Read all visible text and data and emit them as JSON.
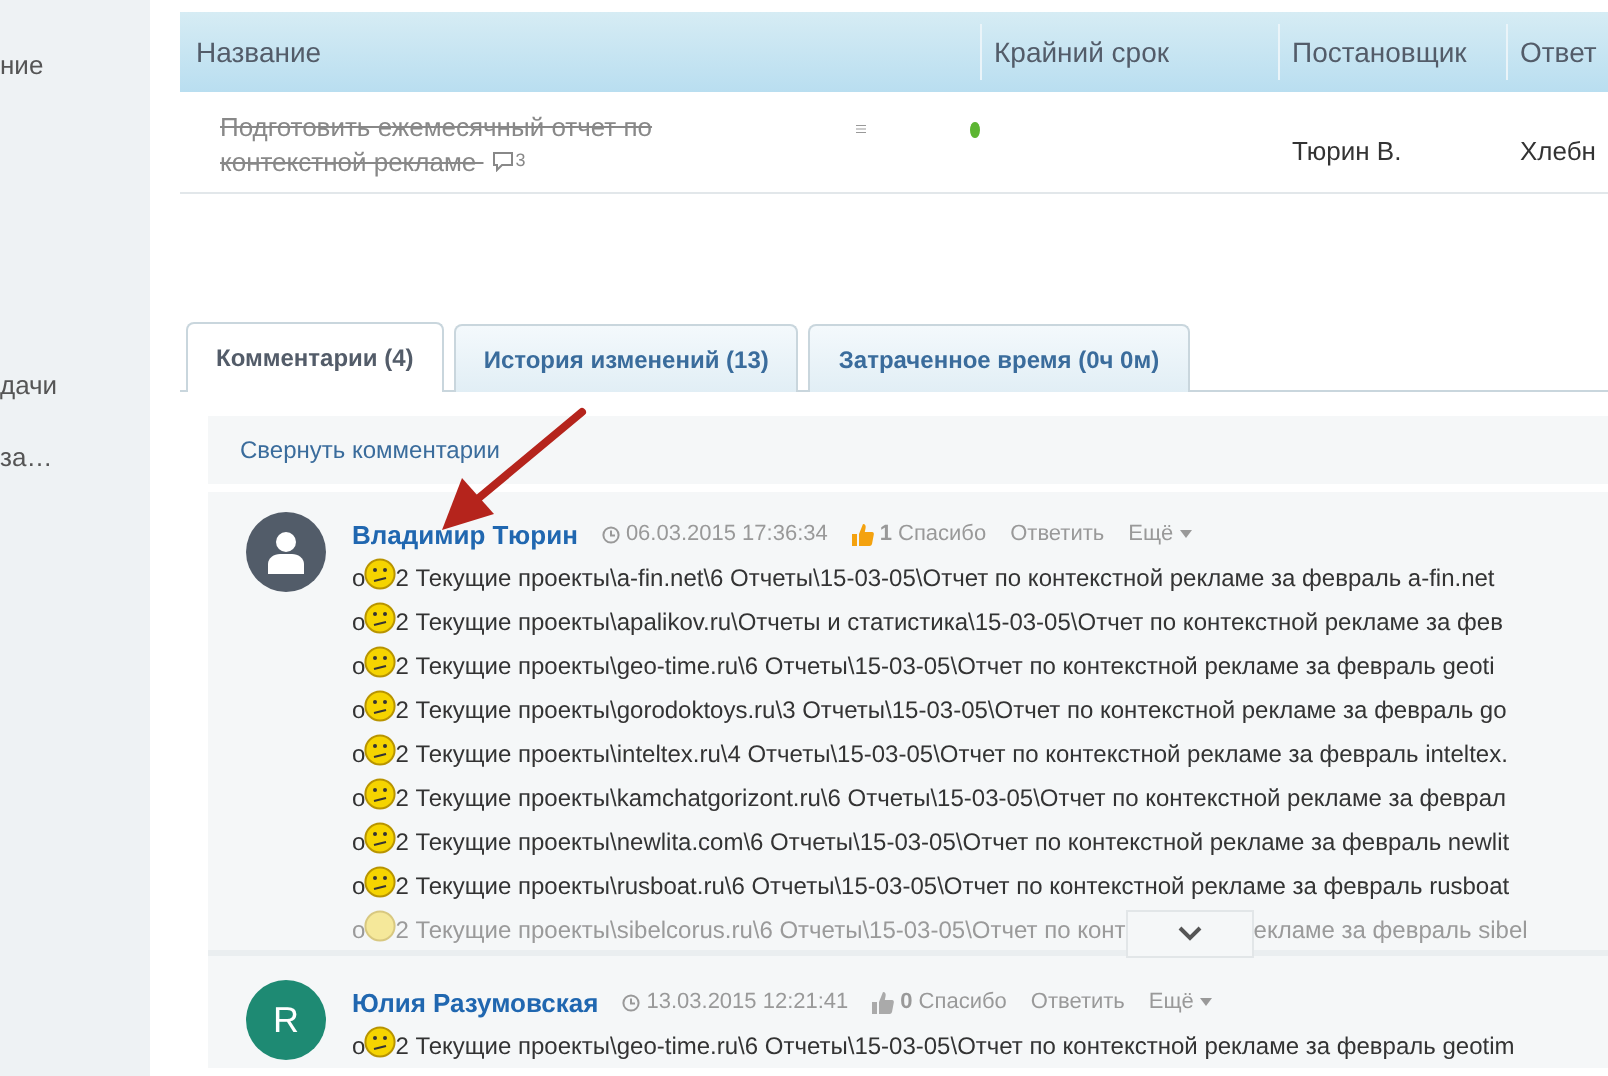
{
  "sidebar": {
    "items": [
      "ние",
      "дачи",
      "за…"
    ]
  },
  "table": {
    "columns": [
      "Название",
      "",
      "Крайний срок",
      "Постановщик",
      "Ответ"
    ],
    "rows": [
      {
        "title": "Подготовить ежемесячный отчет по контекстной рекламе",
        "completed": true,
        "comments": "3",
        "color": "#5cb532",
        "deadline": "",
        "creator": "Тюрин В.",
        "responsible": "Хлебн"
      }
    ]
  },
  "tabs": [
    {
      "label": "Комментарии (4)",
      "selected": true
    },
    {
      "label": "История изменений (13)",
      "selected": false
    },
    {
      "label": "Затраченное время (0ч 0м)",
      "selected": false
    }
  ],
  "collapse_link": "Свернуть комментарии",
  "comments": [
    {
      "author": "Владимир Тюрин",
      "date": "06.03.2015 17:36:34",
      "liked": true,
      "likes": "1",
      "thanks": "Спасибо",
      "reply": "Ответить",
      "more": "Ещё",
      "avatar": {
        "kind": "silhouette",
        "color": "#525c69"
      },
      "lines": [
        {
          "prefix": "o",
          "text": "2 Текущие проекты\\a-fin.net\\6 Отчеты\\15-03-05\\Отчет по контекстной рекламе за февраль a-fin.net"
        },
        {
          "prefix": "o",
          "text": "2 Текущие проекты\\apalikov.ru\\Отчеты и статистика\\15-03-05\\Отчет по контекстной рекламе за фев"
        },
        {
          "prefix": "o",
          "text": "2 Текущие проекты\\geo-time.ru\\6 Отчеты\\15-03-05\\Отчет по контекстной рекламе за февраль geoti"
        },
        {
          "prefix": "o",
          "text": "2 Текущие проекты\\gorodoktoys.ru\\3 Отчеты\\15-03-05\\Отчет по контекстной рекламе за февраль go"
        },
        {
          "prefix": "o",
          "text": "2 Текущие проекты\\inteltex.ru\\4 Отчеты\\15-03-05\\Отчет по контекстной рекламе за февраль inteltex."
        },
        {
          "prefix": "o",
          "text": "2 Текущие проекты\\kamchatgorizont.ru\\6 Отчеты\\15-03-05\\Отчет по контекстной рекламе за феврал"
        },
        {
          "prefix": "o",
          "text": "2 Текущие проекты\\newlita.com\\6 Отчеты\\15-03-05\\Отчет по контекстной рекламе за февраль newlit"
        },
        {
          "prefix": "o",
          "text": "2 Текущие проекты\\rusboat.ru\\6 Отчеты\\15-03-05\\Отчет по контекстной рекламе за февраль rusboat"
        }
      ],
      "faded_line": {
        "prefix": "o",
        "before": "2 Текущие проекты\\sibelcorus.ru\\6 Отчеты\\15-03-05\\Отчет по конт",
        "after": "екламе за февраль sibel"
      }
    },
    {
      "author": "Юлия Разумовская",
      "date": "13.03.2015 12:21:41",
      "liked": false,
      "likes": "0",
      "thanks": "Спасибо",
      "reply": "Ответить",
      "more": "Ещё",
      "avatar": {
        "kind": "initial",
        "letter": "R",
        "color": "#1e8a73"
      },
      "lines": [
        {
          "prefix": "o",
          "text": "2 Текущие проекты\\geo-time.ru\\6 Отчеты\\15-03-05\\Отчет по контекстной рекламе за февраль geotim"
        }
      ]
    }
  ]
}
